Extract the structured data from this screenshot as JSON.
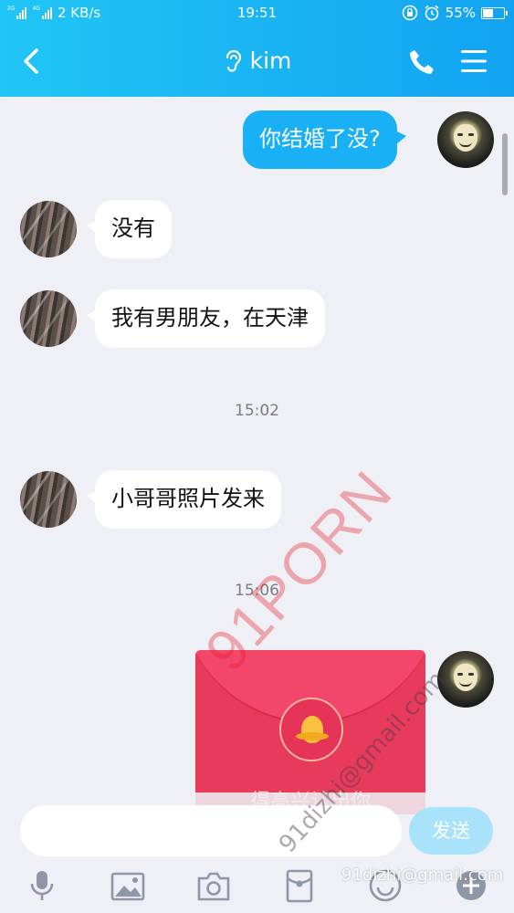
{
  "status_bar": {
    "signal1_label": "2G",
    "signal2_label": "4G",
    "speed": "2 KB/s",
    "time": "19:51",
    "battery": "55%",
    "battery_level": 0.55
  },
  "header": {
    "title": "kim",
    "back_icon": "chevron-left-icon",
    "ear_icon": "ear-icon",
    "phone_icon": "phone-icon",
    "menu_icon": "menu-icon"
  },
  "messages": [
    {
      "side": "out",
      "text": "你结婚了没?"
    },
    {
      "side": "in",
      "text": "没有"
    },
    {
      "side": "in",
      "text": "我有男朋友，在天津"
    },
    {
      "type": "time",
      "text": "15:02"
    },
    {
      "side": "in",
      "text": "小哥哥照片发来"
    },
    {
      "type": "time",
      "text": "15:06"
    },
    {
      "side": "out",
      "type": "red-packet",
      "caption": "得高兴认出你"
    }
  ],
  "input": {
    "send_label": "发送",
    "placeholder": ""
  },
  "toolbar": [
    "microphone-icon",
    "image-icon",
    "camera-icon",
    "red-packet-icon",
    "emoji-icon",
    "plus-icon"
  ],
  "watermark": {
    "main": "91PORN",
    "email": "91dizhi@gmail.com",
    "email_corner": "91dizhi@gmail.com"
  },
  "colors": {
    "header_blue": "#19b3f3",
    "out_bubble": "#1ab0f5",
    "red_packet": "#e83a5a",
    "chat_bg": "#eff0f5"
  }
}
